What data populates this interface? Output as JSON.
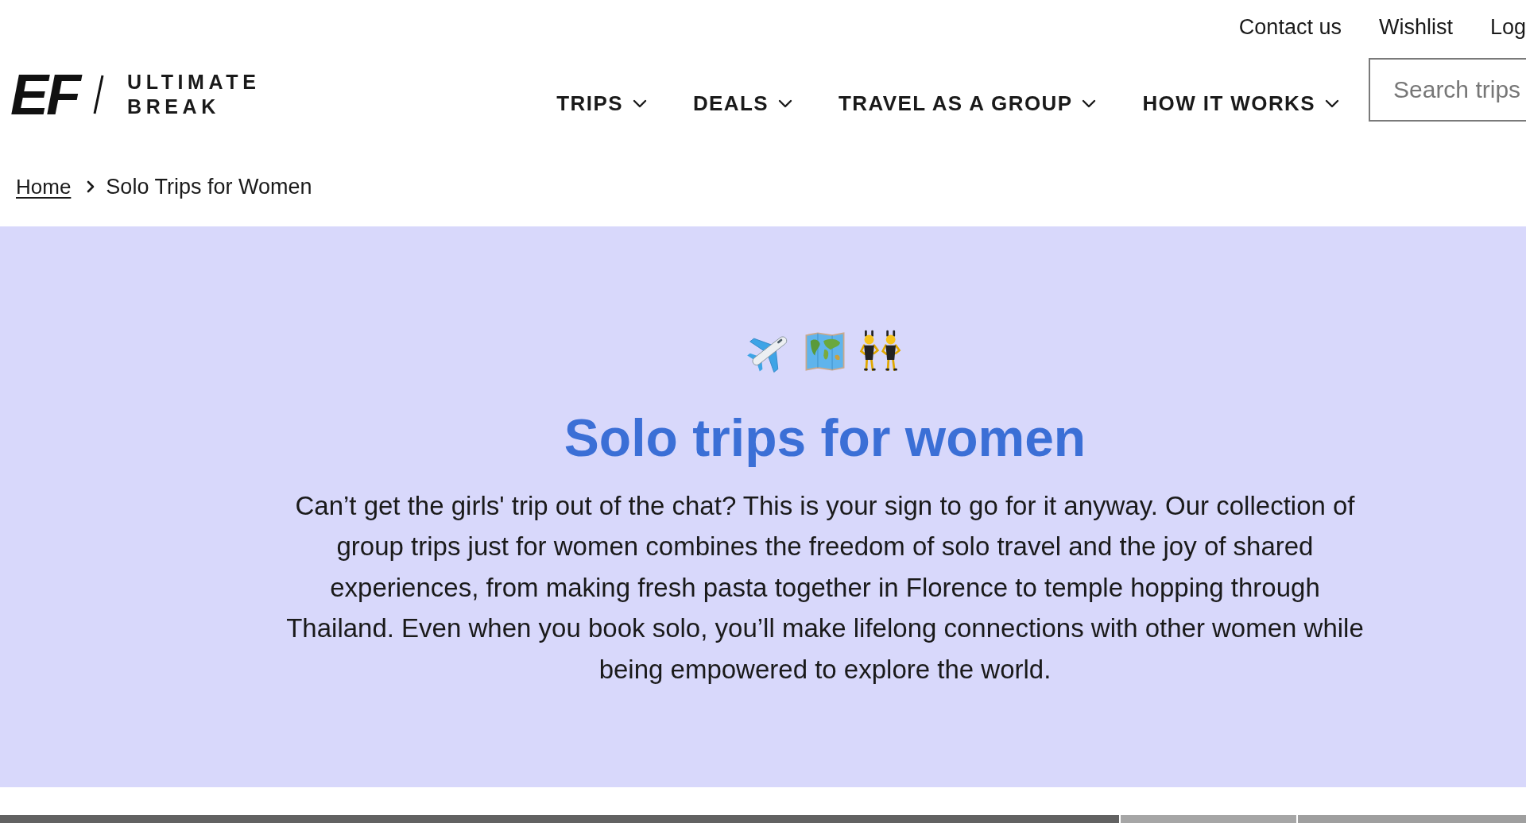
{
  "top_links": [
    {
      "label": "Contact us"
    },
    {
      "label": "Wishlist"
    },
    {
      "label": "Log"
    }
  ],
  "logo": {
    "mark": "EF",
    "lines": [
      "ULTIMATE",
      "BREAK"
    ]
  },
  "nav": [
    {
      "label": "TRIPS",
      "dropdown": true
    },
    {
      "label": "DEALS",
      "dropdown": true
    },
    {
      "label": "TRAVEL AS A GROUP",
      "dropdown": true
    },
    {
      "label": "HOW IT WORKS",
      "dropdown": true
    }
  ],
  "search": {
    "placeholder": "Search trips"
  },
  "breadcrumb": [
    {
      "label": "Home",
      "kind": "link"
    },
    {
      "label": "Solo Trips for Women",
      "kind": "current"
    }
  ],
  "hero": {
    "title": "Solo trips for women",
    "text": "Can’t get the girls' trip out of the chat? This is your sign to go for it anyway. Our collection of group trips just for women combines the freedom of solo travel and the joy of shared experiences, from making fresh pasta together in Florence to temple hopping through Thailand. Even when you book solo, you’ll make lifelong connections with other women while being empowered to explore the world."
  }
}
